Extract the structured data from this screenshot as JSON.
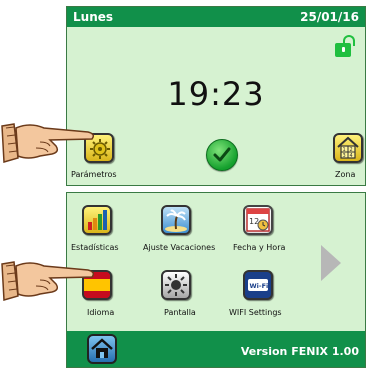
{
  "home": {
    "day": "Lunes",
    "date": "25/01/16",
    "time": "19:23",
    "parametros_label": "Parámetros",
    "zona_label": "Zona"
  },
  "menu": {
    "items": [
      {
        "label": "Estadísticas"
      },
      {
        "label": "Ajuste Vacaciones"
      },
      {
        "label": "Fecha y Hora"
      },
      {
        "label": "Idioma"
      },
      {
        "label": "Pantalla"
      },
      {
        "label": "WIFI Settings"
      }
    ],
    "version": "Version FENIX 1.00",
    "calendar_day": "12",
    "wifi_text": "Wi-Fi"
  },
  "colors": {
    "title_bar": "#11904a",
    "screen_bg": "#d6f2d1",
    "accent_green": "#1fbf3f"
  }
}
